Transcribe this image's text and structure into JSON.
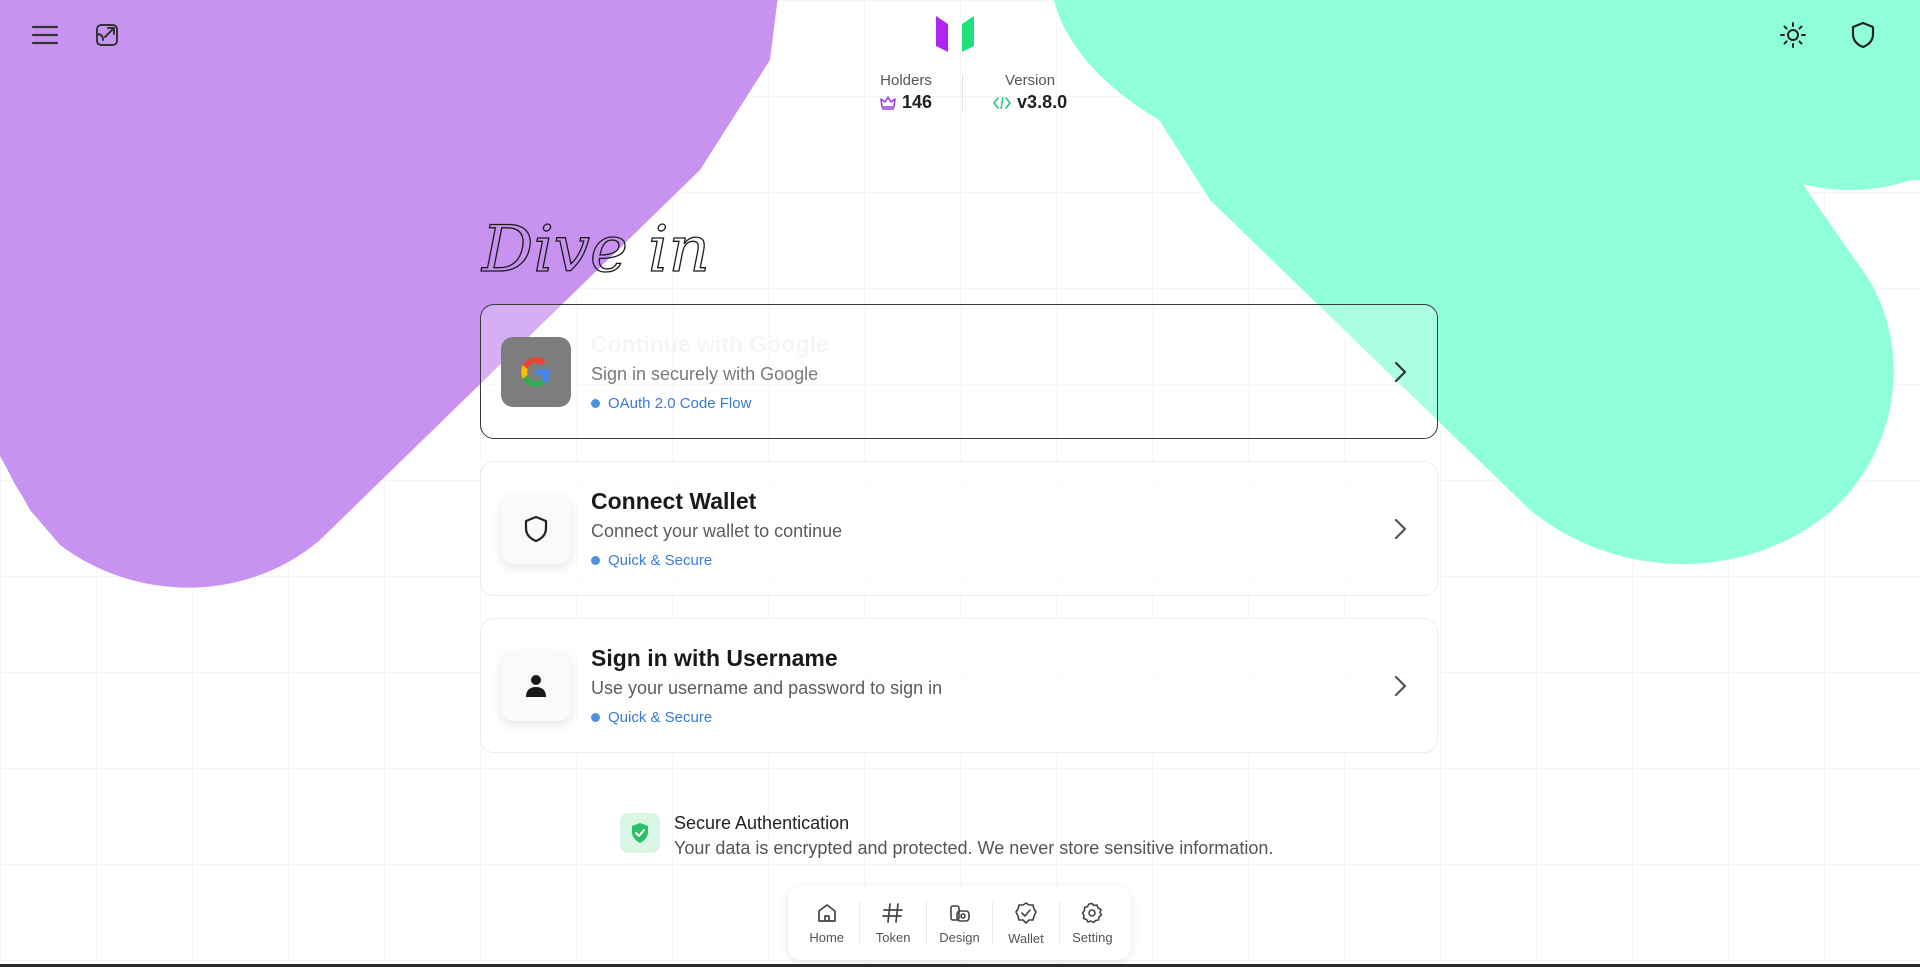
{
  "app": {
    "colors": {
      "purple_blob": "#c893f0",
      "mint_blob": "#8effd9",
      "logo_purple": "#b224ef",
      "logo_green": "#1fe07a",
      "link_blue": "#3a7bd5",
      "secure_green": "#27c266"
    }
  },
  "header": {
    "menu_icon": "hamburger-menu-icon",
    "expand_icon": "open-external-icon",
    "theme_icon": "sun-icon",
    "security_icon": "shield-icon"
  },
  "stats": {
    "holders_label": "Holders",
    "holders_value": "146",
    "version_label": "Version",
    "version_value": "v3.8.0"
  },
  "headline": "Dive in",
  "cards": [
    {
      "title": "Continue with Google",
      "description": "Sign in securely with Google",
      "badge": "OAuth 2.0 Code Flow",
      "icon": "google-icon"
    },
    {
      "title": "Connect Wallet",
      "description": "Connect your wallet to continue",
      "badge": "Quick & Secure",
      "icon": "shield-icon"
    },
    {
      "title": "Sign in with Username",
      "description": "Use your username and password to sign in",
      "badge": "Quick & Secure",
      "icon": "user-icon"
    }
  ],
  "secure": {
    "title": "Secure Authentication",
    "description": "Your data is encrypted and protected. We never store sensitive information."
  },
  "nav": {
    "items": [
      {
        "label": "Home",
        "icon": "home-icon"
      },
      {
        "label": "Token",
        "icon": "hash-icon"
      },
      {
        "label": "Design",
        "icon": "design-icon"
      },
      {
        "label": "Wallet",
        "icon": "wallet-check-icon"
      },
      {
        "label": "Setting",
        "icon": "gear-icon"
      }
    ]
  }
}
